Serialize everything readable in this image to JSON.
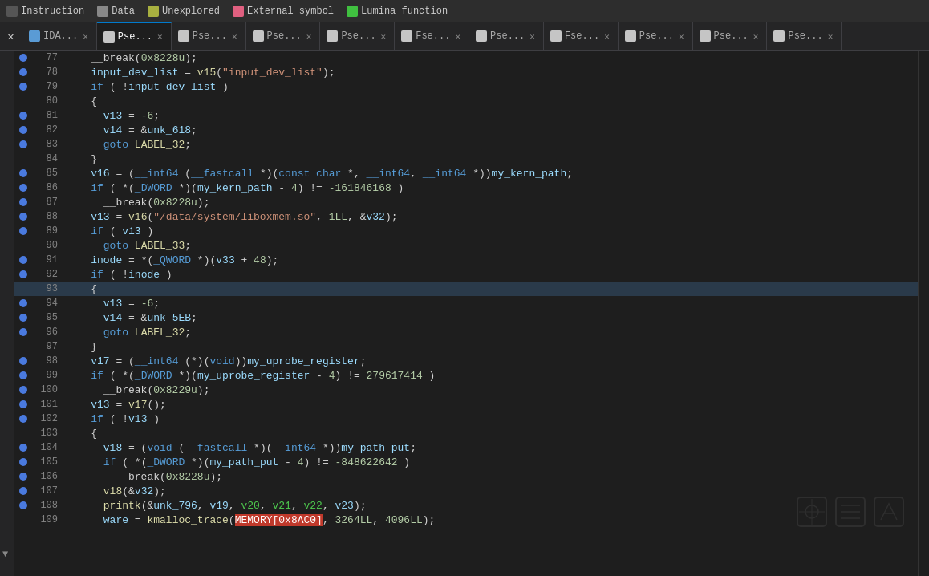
{
  "legend": {
    "items": [
      {
        "label": "Instruction",
        "color": "#555555"
      },
      {
        "label": "Data",
        "color": "#888888"
      },
      {
        "label": "Unexplored",
        "color": "#a8b040"
      },
      {
        "label": "External symbol",
        "color": "#e06080"
      },
      {
        "label": "Lumina function",
        "color": "#40c040"
      }
    ]
  },
  "tabs": [
    {
      "id": "ida",
      "label": "IDA...",
      "active": false,
      "closeable": true
    },
    {
      "id": "pse1",
      "label": "Pse...",
      "active": true,
      "closeable": true
    },
    {
      "id": "pse2",
      "label": "Pse...",
      "active": false,
      "closeable": true
    },
    {
      "id": "pse3",
      "label": "Pse...",
      "active": false,
      "closeable": true
    },
    {
      "id": "pse4",
      "label": "Pse...",
      "active": false,
      "closeable": true
    },
    {
      "id": "fse1",
      "label": "Fse...",
      "active": false,
      "closeable": true
    },
    {
      "id": "pse5",
      "label": "Pse...",
      "active": false,
      "closeable": true
    },
    {
      "id": "fse2",
      "label": "Fse...",
      "active": false,
      "closeable": true
    },
    {
      "id": "pse6",
      "label": "Pse...",
      "active": false,
      "closeable": true
    },
    {
      "id": "pse7",
      "label": "Pse...",
      "active": false,
      "closeable": true
    },
    {
      "id": "pse8",
      "label": "Pse...",
      "active": false,
      "closeable": true
    }
  ],
  "lines": [
    {
      "num": 77,
      "code": "    __break(0x8228u);",
      "bp": true
    },
    {
      "num": 78,
      "code": "    input_dev_list = v15(\"input_dev_list\");",
      "bp": true
    },
    {
      "num": 79,
      "code": "    if ( !input_dev_list )",
      "bp": true
    },
    {
      "num": 80,
      "code": "    {",
      "bp": false
    },
    {
      "num": 81,
      "code": "      v13 = -6;",
      "bp": true
    },
    {
      "num": 82,
      "code": "      v14 = &unk_618;",
      "bp": true
    },
    {
      "num": 83,
      "code": "      goto LABEL_32;",
      "bp": true
    },
    {
      "num": 84,
      "code": "    }",
      "bp": false
    },
    {
      "num": 85,
      "code": "    v16 = (__int64 (__fastcall *)(const char *, __int64, __int64 *))my_kern_path;",
      "bp": true
    },
    {
      "num": 86,
      "code": "    if ( *(_DWORD *)(my_kern_path - 4) != -161846168 )",
      "bp": true
    },
    {
      "num": 87,
      "code": "      __break(0x8228u);",
      "bp": true
    },
    {
      "num": 88,
      "code": "    v13 = v16(\"/data/system/liboxmem.so\", 1LL, &v32);",
      "bp": true
    },
    {
      "num": 89,
      "code": "    if ( v13 )",
      "bp": true
    },
    {
      "num": 90,
      "code": "      goto LABEL_33;",
      "bp": false
    },
    {
      "num": 91,
      "code": "    inode = *(_QWORD *)(v33 + 48);",
      "bp": true
    },
    {
      "num": 92,
      "code": "    if ( !inode )",
      "bp": true
    },
    {
      "num": 93,
      "code": "    {",
      "bp": false,
      "highlight": true
    },
    {
      "num": 94,
      "code": "      v13 = -6;",
      "bp": true
    },
    {
      "num": 95,
      "code": "      v14 = &unk_5EB;",
      "bp": true
    },
    {
      "num": 96,
      "code": "      goto LABEL_32;",
      "bp": true
    },
    {
      "num": 97,
      "code": "    }",
      "bp": false
    },
    {
      "num": 98,
      "code": "    v17 = (__int64 (*)(void))my_uprobe_register;",
      "bp": true
    },
    {
      "num": 99,
      "code": "    if ( *(_DWORD *)(my_uprobe_register - 4) != 279617414 )",
      "bp": true
    },
    {
      "num": 100,
      "code": "      __break(0x8229u);",
      "bp": true
    },
    {
      "num": 101,
      "code": "    v13 = v17();",
      "bp": true
    },
    {
      "num": 102,
      "code": "    if ( !v13 )",
      "bp": true
    },
    {
      "num": 103,
      "code": "    {",
      "bp": false
    },
    {
      "num": 104,
      "code": "      v18 = (void (__fastcall *)(__int64 *))my_path_put;",
      "bp": true
    },
    {
      "num": 105,
      "code": "      if ( *(_DWORD *)(my_path_put - 4) != -848622642 )",
      "bp": true
    },
    {
      "num": 106,
      "code": "        __break(0x8228u);",
      "bp": true
    },
    {
      "num": 107,
      "code": "      v18(&v32);",
      "bp": true
    },
    {
      "num": 108,
      "code": "      printk(&unk_796, v19, v20, v21, v22, v23);",
      "bp": true
    },
    {
      "num": 109,
      "code": "      ware = kmalloc_trace(MEMORY[0x8AC0], 3264LL, 4096LL);",
      "bp": false,
      "partial_red": true
    }
  ]
}
